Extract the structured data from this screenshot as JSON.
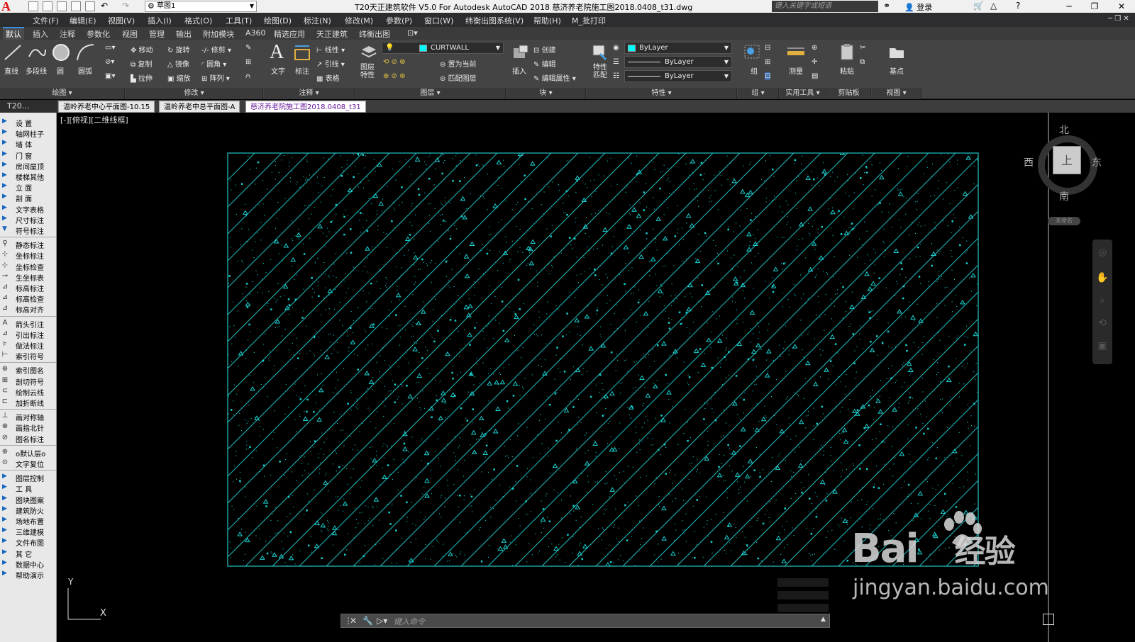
{
  "titlebar": {
    "app_logo": "A",
    "workspace": "草图1",
    "title": "T20天正建筑软件 V5.0 For Autodesk AutoCAD 2018     慈济养老院施工图2018.0408_t31.dwg",
    "search_placeholder": "键入关键字或短语",
    "login": "登录"
  },
  "menu": [
    "文件(F)",
    "编辑(E)",
    "视图(V)",
    "插入(I)",
    "格式(O)",
    "工具(T)",
    "绘图(D)",
    "标注(N)",
    "修改(M)",
    "参数(P)",
    "窗口(W)",
    "纬衡出图系统(V)",
    "帮助(H)",
    "M_批打印"
  ],
  "ribbon_tabs": [
    "默认",
    "插入",
    "注释",
    "参数化",
    "视图",
    "管理",
    "输出",
    "附加模块",
    "A360",
    "精选应用",
    "天正建筑",
    "纬衡出图"
  ],
  "ribbon": {
    "draw": {
      "line": "直线",
      "polyline": "多段线",
      "circle": "圆",
      "arc": "圆弧",
      "footer": "绘图"
    },
    "modify": {
      "move": "移动",
      "rotate": "旋转",
      "trim": "修剪",
      "copy": "复制",
      "mirror": "镜像",
      "fillet": "圆角",
      "stretch": "拉伸",
      "scale": "缩放",
      "array": "阵列",
      "footer": "修改"
    },
    "annotation": {
      "text": "文字",
      "dim": "标注",
      "linear": "线性",
      "leader": "引线",
      "table": "表格",
      "footer": "注释"
    },
    "layers": {
      "props": "图层\n特性",
      "current": "CURTWALL",
      "set_current": "置为当前",
      "match": "匹配图层",
      "footer": "图层"
    },
    "block": {
      "insert": "插入",
      "create": "创建",
      "edit": "编辑",
      "edit_attr": "编辑属性",
      "footer": "块"
    },
    "properties": {
      "match": "特性\n匹配",
      "color": "ByLayer",
      "linetype": "ByLayer",
      "lineweight": "ByLayer",
      "footer": "特性"
    },
    "groups": {
      "group": "组",
      "footer": "组"
    },
    "utilities": {
      "measure": "测量",
      "footer": "实用工具"
    },
    "clipboard": {
      "paste": "粘贴",
      "footer": "剪贴板"
    },
    "view": {
      "base": "基点",
      "footer": "视图"
    }
  },
  "filetabs": {
    "t20": "T20...",
    "tabs": [
      "温岭养老中心平面图-10.15",
      "温岭养老中总平面图-A",
      "慈济养老院施工图2018.0408_t31"
    ]
  },
  "palette": [
    {
      "label": "设    置",
      "type": "arrow"
    },
    {
      "label": "轴网柱子",
      "type": "arrow"
    },
    {
      "label": "墙    体",
      "type": "arrow"
    },
    {
      "label": "门    窗",
      "type": "arrow"
    },
    {
      "label": "房间屋顶",
      "type": "arrow"
    },
    {
      "label": "楼梯其他",
      "type": "arrow"
    },
    {
      "label": "立    面",
      "type": "arrow"
    },
    {
      "label": "剖    面",
      "type": "arrow"
    },
    {
      "label": "文字表格",
      "type": "arrow"
    },
    {
      "label": "尺寸标注",
      "type": "arrow"
    },
    {
      "label": "符号标注",
      "type": "open"
    },
    {
      "label": "静态标注",
      "type": "icon"
    },
    {
      "label": "坐标标注",
      "type": "icon"
    },
    {
      "label": "坐标检查",
      "type": "icon"
    },
    {
      "label": "生坐标表",
      "type": "icon"
    },
    {
      "label": "标高标注",
      "type": "icon"
    },
    {
      "label": "标高检查",
      "type": "icon"
    },
    {
      "label": "标高对齐",
      "type": "icon"
    },
    {
      "label": "箭头引注",
      "type": "icon"
    },
    {
      "label": "引出标注",
      "type": "icon"
    },
    {
      "label": "做法标注",
      "type": "icon"
    },
    {
      "label": "索引符号",
      "type": "icon"
    },
    {
      "label": "索引图名",
      "type": "icon"
    },
    {
      "label": "剖切符号",
      "type": "icon"
    },
    {
      "label": "绘制云线",
      "type": "icon"
    },
    {
      "label": "加折断线",
      "type": "icon"
    },
    {
      "label": "画对称轴",
      "type": "icon"
    },
    {
      "label": "画指北针",
      "type": "icon"
    },
    {
      "label": "图名标注",
      "type": "icon"
    },
    {
      "label": "o默认层o",
      "type": "icon"
    },
    {
      "label": "文字复位",
      "type": "icon"
    },
    {
      "label": "图层控制",
      "type": "arrow"
    },
    {
      "label": "工    具",
      "type": "arrow"
    },
    {
      "label": "图块图案",
      "type": "arrow"
    },
    {
      "label": "建筑防火",
      "type": "arrow"
    },
    {
      "label": "场地布置",
      "type": "arrow"
    },
    {
      "label": "三维建模",
      "type": "arrow"
    },
    {
      "label": "文件布图",
      "type": "arrow"
    },
    {
      "label": "其    它",
      "type": "arrow"
    },
    {
      "label": "数据中心",
      "type": "arrow"
    },
    {
      "label": "帮助演示",
      "type": "arrow"
    }
  ],
  "viewport": {
    "label": "[-][俯视][二维线框]",
    "hatch_color": "#1fb5b5",
    "dot_color": "#19d0d0"
  },
  "viewcube": {
    "north": "北",
    "south": "南",
    "east": "东",
    "west": "西",
    "face": "上",
    "ucs": "未命名"
  },
  "ucs": {
    "x": "X",
    "y": "Y"
  },
  "command": {
    "placeholder": "键入命令"
  },
  "watermark": {
    "brand": "Bai",
    "brand2": "经验",
    "url": "jingyan.baidu.com"
  }
}
